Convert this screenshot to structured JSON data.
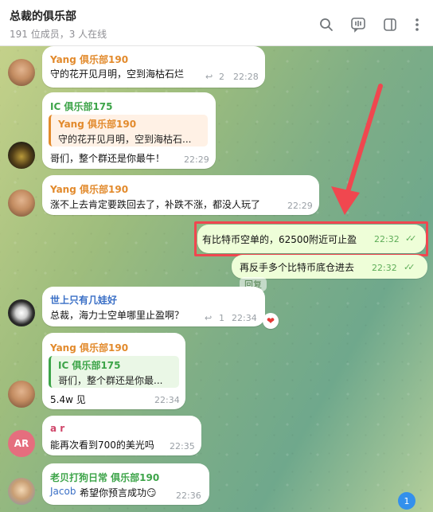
{
  "header": {
    "title": "总裁的俱乐部",
    "subtitle": "191 位成员，3 人在线",
    "icons": [
      "search-icon",
      "video-chat-icon",
      "sidebar-icon",
      "more-icon"
    ]
  },
  "messages": [
    {
      "sender": "Yang 俱乐部190",
      "text": "守的花开见月明，空到海枯石烂",
      "replies": "2",
      "time": "22:28"
    },
    {
      "sender": "IC 俱乐部175",
      "quote_name": "Yang 俱乐部190",
      "quote_text": "守的花开见月明，空到海枯石...",
      "text": "哥们，整个群还是你最牛！",
      "time": "22:29"
    },
    {
      "sender": "Yang 俱乐部190",
      "text": "涨不上去肯定要跌回去了，补跌不涨，都没人玩了",
      "time": "22:29"
    },
    {
      "text": "有比特币空单的，62500附近可止盈",
      "time": "22:32"
    },
    {
      "text": "再反手多个比特币底仓进去",
      "time": "22:32"
    },
    {
      "reply_chip": "回复"
    },
    {
      "sender": "世上只有几娃好",
      "text": "总裁，海力士空单哪里止盈啊？",
      "replies": "1",
      "time": "22:34",
      "reaction": "❤"
    },
    {
      "sender": "Yang 俱乐部190",
      "quote_name": "IC 俱乐部175",
      "quote_text": "哥们，整个群还是你最...",
      "text": "5.4w 见",
      "time": "22:34"
    },
    {
      "sender": "a r",
      "avatar_initials": "AR",
      "text": "能再次看到700的美光吗",
      "time": "22:35"
    },
    {
      "sender": "老贝打狗日常 俱乐部190",
      "text_link": "Jacob",
      "text": "希望你预言成功😏",
      "time": "22:36"
    }
  ],
  "unread_count": "1",
  "colors": {
    "accent": "#3390ec",
    "outgoing": "#eefed8",
    "highlight": "#f0474f"
  }
}
